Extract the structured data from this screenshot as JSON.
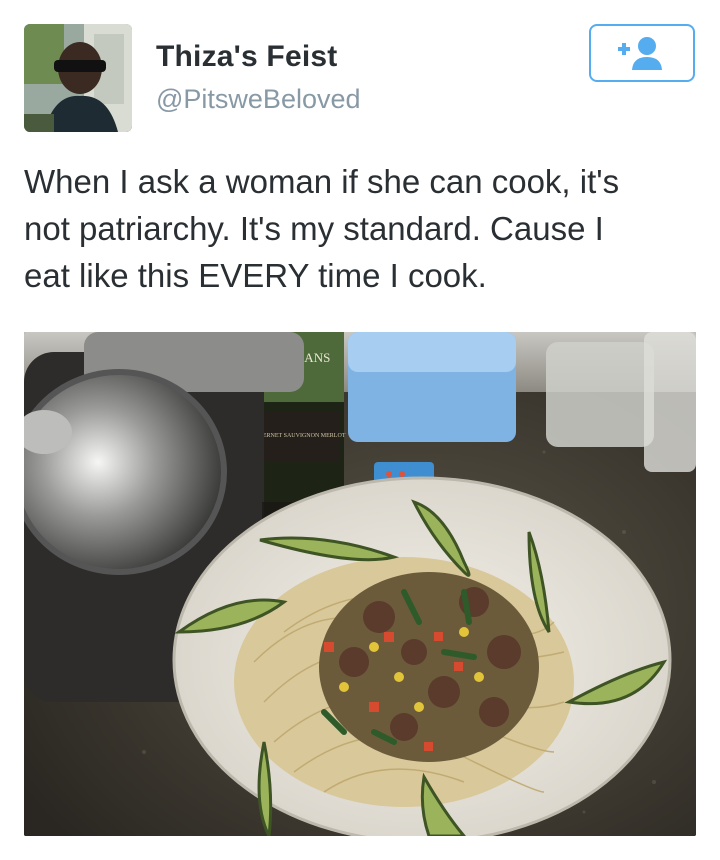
{
  "tweet": {
    "display_name": "Thiza's Feist",
    "handle": "@PitsweBeloved",
    "text": "When I ask a woman if she can cook, it's\nnot patriarchy. It's my standard. Cause I\neat like this EVERY time I cook."
  },
  "follow_button": {
    "icon": "add-user-icon",
    "color": "#55acee"
  },
  "photo": {
    "wine_label_brand": "O OCEANS",
    "wine_label_variety": "CABERNET SAUVIGNON MERLOT"
  },
  "colors": {
    "accent": "#55acee",
    "text": "#292f33",
    "muted": "#8899a6"
  }
}
